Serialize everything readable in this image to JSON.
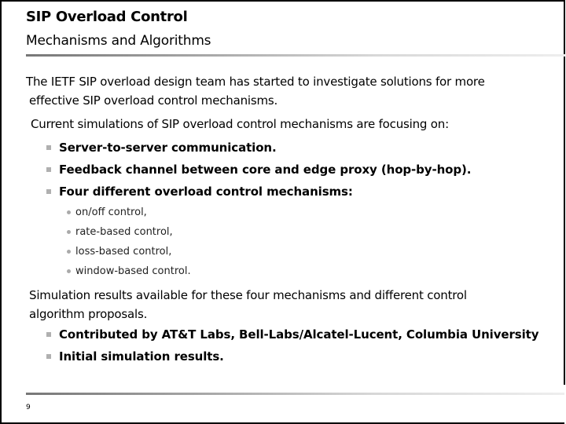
{
  "slide": {
    "title": "SIP Overload Control",
    "subtitle": "Mechanisms and Algorithms",
    "page_number": "9",
    "accent_rule_colors": [
      "#777777",
      "#eeeeee"
    ]
  },
  "body": {
    "intro": {
      "line1": "The IETF SIP overload design team has started to investigate solutions for more",
      "line2": "effective SIP overload control mechanisms."
    },
    "focus": {
      "heading": "Current simulations of SIP overload control mechanisms are focusing on:",
      "bullets": [
        {
          "label": "Server-to-server communication."
        },
        {
          "label": "Feedback channel between core and edge proxy (hop-by-hop)."
        },
        {
          "label": "Four different overload control mechanisms:",
          "sub": [
            {
              "label": "on/off control,"
            },
            {
              "label": "rate-based control,"
            },
            {
              "label": "loss-based control,"
            },
            {
              "label": "window-based control."
            }
          ]
        }
      ]
    },
    "results": {
      "line1": "Simulation results available for these four mechanisms and different control",
      "line2": "algorithm proposals.",
      "bullets": [
        {
          "label": "Contributed by AT&T Labs, Bell-Labs/Alcatel-Lucent, Columbia University"
        },
        {
          "label": "Initial simulation results."
        }
      ]
    }
  }
}
